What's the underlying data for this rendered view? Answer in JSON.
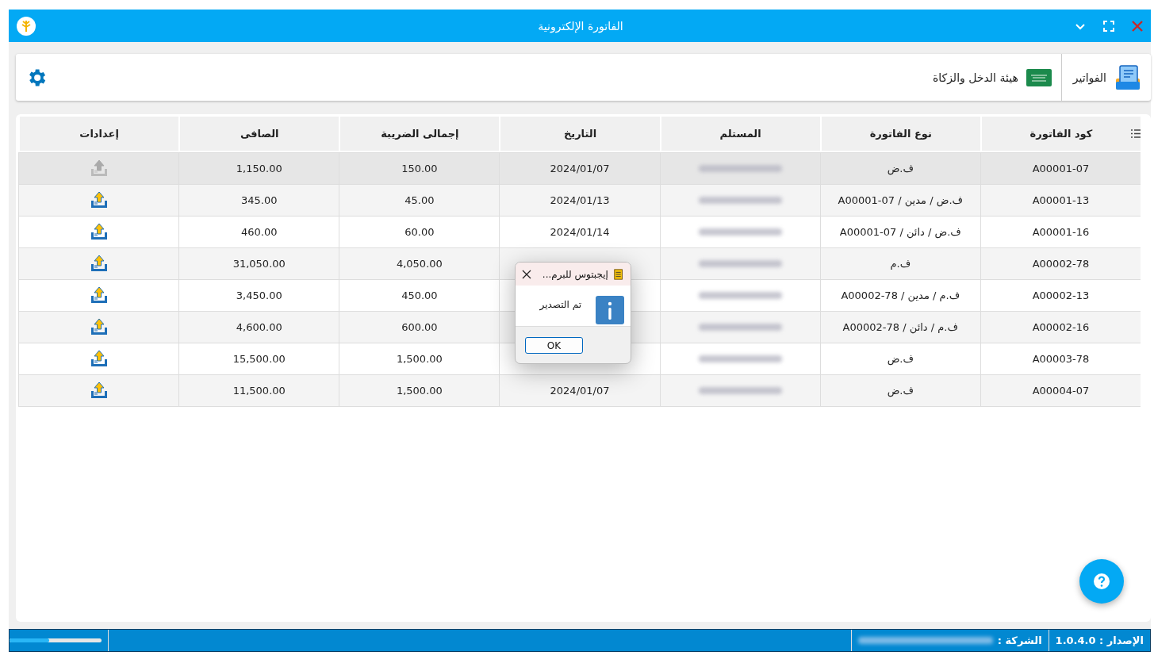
{
  "window": {
    "title": "الفاتورة الإلكترونية"
  },
  "header": {
    "nav_items": [
      {
        "label": "الفواتير"
      },
      {
        "label": "هيئة الدخل والزكاة"
      }
    ]
  },
  "table": {
    "columns": [
      "كود الفاتورة",
      "نوع الفاتورة",
      "المستلم",
      "التاريخ",
      "إجمالى الضريبة",
      "الصافى",
      "إعدادات"
    ],
    "rows": [
      {
        "code": "A00001-07",
        "type": "ف.ض",
        "date": "2024/01/07",
        "tax": "150.00",
        "net": "1,150.00",
        "export_enabled": false,
        "selected": true
      },
      {
        "code": "A00001-13",
        "type": "ف.ض / مدين / A00001-07",
        "date": "2024/01/13",
        "tax": "45.00",
        "net": "345.00",
        "export_enabled": true,
        "selected": false
      },
      {
        "code": "A00001-16",
        "type": "ف.ض / دائن / A00001-07",
        "date": "2024/01/14",
        "tax": "60.00",
        "net": "460.00",
        "export_enabled": true,
        "selected": false
      },
      {
        "code": "A00002-78",
        "type": "ف.م",
        "tax": "4,050.00",
        "net": "31,050.00",
        "export_enabled": true,
        "selected": false
      },
      {
        "code": "A00002-13",
        "type": "ف.م / مدين / A00002-78",
        "tax": "450.00",
        "net": "3,450.00",
        "export_enabled": true,
        "selected": false
      },
      {
        "code": "A00002-16",
        "type": "ف.م / دائن / A00002-78",
        "tax": "600.00",
        "net": "4,600.00",
        "export_enabled": true,
        "selected": false
      },
      {
        "code": "A00003-78",
        "type": "ف.ض",
        "tax": "1,500.00",
        "net": "15,500.00",
        "export_enabled": true,
        "selected": false
      },
      {
        "code": "A00004-07",
        "type": "ف.ض",
        "date": "2024/01/07",
        "tax": "1,500.00",
        "net": "11,500.00",
        "export_enabled": true,
        "selected": false
      }
    ]
  },
  "dialog": {
    "title": "إيجبتوس للبرم...",
    "message": "تم التصدير",
    "button": "OK"
  },
  "status_bar": {
    "version": "الإصدار : 1.0.4.0",
    "company_label": "الشركة :",
    "progress": {
      "level": 0.43
    }
  }
}
